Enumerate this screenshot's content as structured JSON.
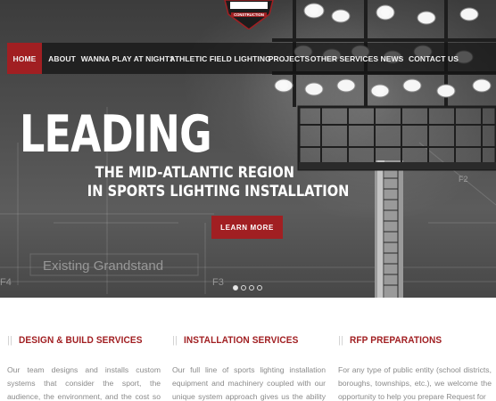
{
  "logo": {
    "text": "CONSTRUCTION"
  },
  "nav": {
    "items": [
      {
        "label": "HOME",
        "active": true
      },
      {
        "label": "ABOUT",
        "active": false
      },
      {
        "label": "WANNA PLAY AT NIGHT?",
        "active": false
      },
      {
        "label": "ATHLETIC FIELD LIGHTING",
        "active": false
      },
      {
        "label": "PROJECTS",
        "active": false
      },
      {
        "label": "OTHER SERVICES",
        "active": false
      },
      {
        "label": "NEWS",
        "active": false
      },
      {
        "label": "CONTACT US",
        "active": false
      }
    ]
  },
  "hero": {
    "headline": "LEADING",
    "subline_1": "THE MID-ATLANTIC REGION",
    "subline_2": "IN SPORTS LIGHTING INSTALLATION",
    "cta_label": "LEARN MORE",
    "sketch_label": "Existing Grandstand",
    "sketch_marks": [
      "F4",
      "F3",
      "F2"
    ],
    "slide_count": 4,
    "active_slide": 1
  },
  "features": [
    {
      "title": "DESIGN & BUILD SERVICES",
      "text": "Our team designs and installs custom systems that consider the sport, the audience, the environment, and the cost so we can create"
    },
    {
      "title": "INSTALLATION SERVICES",
      "text": "Our full line of sports lighting installation equipment and machinery coupled with our unique system approach gives us the ability to"
    },
    {
      "title": "RFP PREPARATIONS",
      "text": "For any type of public entity (school districts, boroughs, townships, etc.), we welcome the opportunity to help you prepare Request for"
    }
  ],
  "colors": {
    "accent": "#a11f22",
    "nav_bg": "#1a1a1a",
    "body_text": "#8a8a8a"
  }
}
